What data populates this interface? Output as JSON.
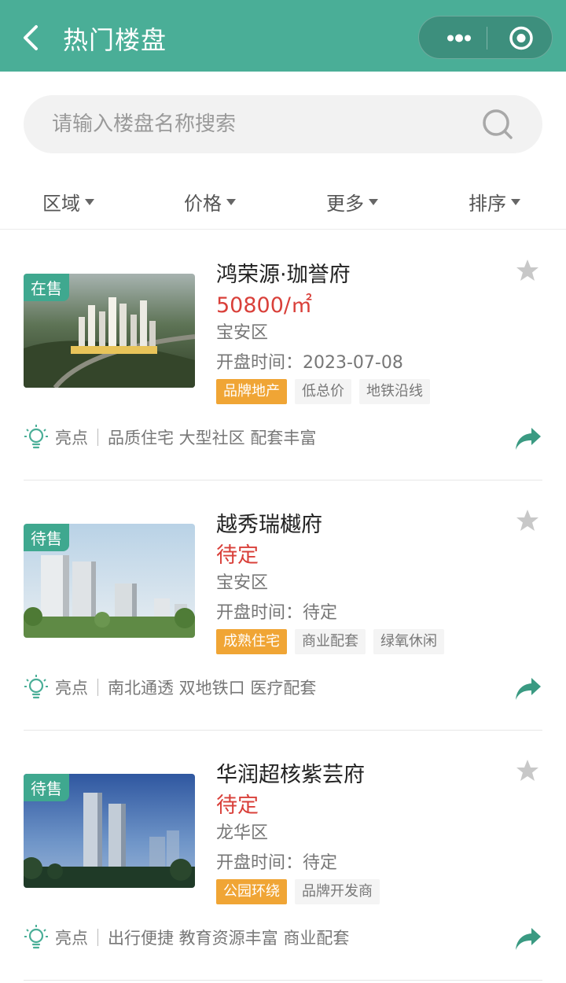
{
  "header": {
    "title": "热门楼盘",
    "back_icon": "chevron-left-icon",
    "more_icon": "more-dots-icon",
    "close_icon": "target-circle-icon"
  },
  "search": {
    "placeholder": "请输入楼盘名称搜索",
    "icon": "search-icon"
  },
  "filters": [
    {
      "label": "区域"
    },
    {
      "label": "价格"
    },
    {
      "label": "更多"
    },
    {
      "label": "排序"
    }
  ],
  "listings": [
    {
      "status": "在售",
      "name": "鸿荣源·珈誉府",
      "price": "50800/㎡",
      "district": "宝安区",
      "open_time": "开盘时间：2023-07-08",
      "tags": [
        "品牌地产",
        "低总价",
        "地铁沿线"
      ],
      "highlight_label": "亮点",
      "highlights": "品质住宅 大型社区 配套丰富"
    },
    {
      "status": "待售",
      "name": "越秀瑞樾府",
      "price": "待定",
      "district": "宝安区",
      "open_time": "开盘时间：待定",
      "tags": [
        "成熟住宅",
        "商业配套",
        "绿氧休闲"
      ],
      "highlight_label": "亮点",
      "highlights": "南北通透 双地铁口 医疗配套"
    },
    {
      "status": "待售",
      "name": "华润超核紫芸府",
      "price": "待定",
      "district": "龙华区",
      "open_time": "开盘时间：待定",
      "tags": [
        "公园环绕",
        "品牌开发商"
      ],
      "highlight_label": "亮点",
      "highlights": "出行便捷 教育资源丰富 商业配套"
    }
  ],
  "colors": {
    "header": "#4aae97",
    "status_badge": "#3fa88f",
    "price": "#d9403a",
    "highlight_tag": "#f0a535",
    "share_icon": "#3a9a82"
  }
}
